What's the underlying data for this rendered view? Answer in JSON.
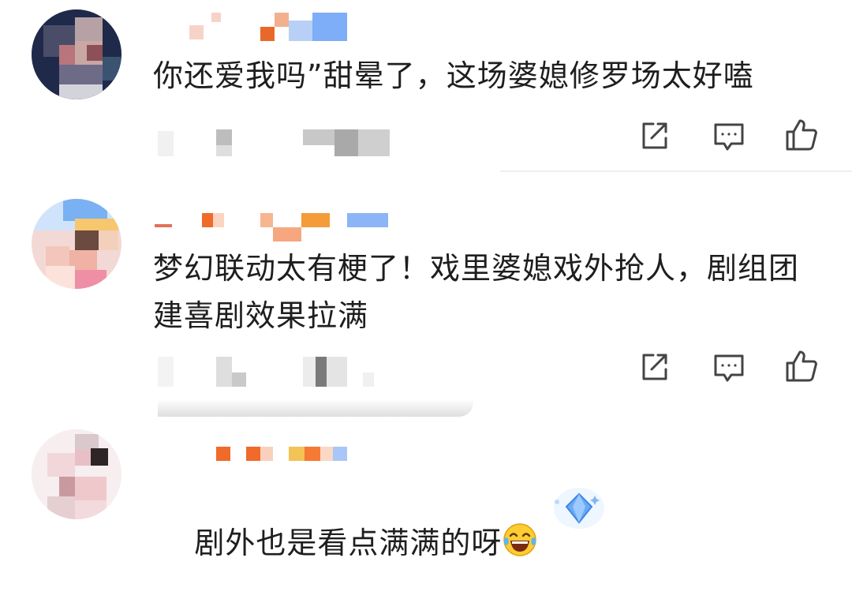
{
  "comments": [
    {
      "text": "你还爱我吗”甜晕了，这场婆媳修罗场太好嗑",
      "name_colors": [
        "#f7d3c7",
        "#e8682a",
        "#f2b08f",
        "#7eaef7",
        "#b8d0f5"
      ]
    },
    {
      "text": "梦幻联动太有梗了！戏里婆媳戏外抢人，剧组团建喜剧效果拉满",
      "name_colors": [
        "#f06a2a",
        "#f7b690",
        "#f49b3a",
        "#8bb5f7"
      ]
    },
    {
      "text": "剧外也是看点满满的呀",
      "emoji": "laughing-tears-emoji",
      "name_colors": [
        "#f06a2a",
        "#f47a35",
        "#f3c356",
        "#a9c7f6"
      ]
    }
  ],
  "actions": {
    "repost_icon": "repost-icon",
    "comment_icon": "comment-icon",
    "like_icon": "like-icon"
  },
  "colors": {
    "icon": "#444444",
    "divider": "#efefef",
    "text": "#1e1e1e"
  }
}
